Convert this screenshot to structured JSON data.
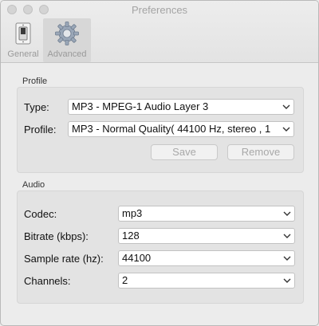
{
  "window": {
    "title": "Preferences"
  },
  "toolbar": {
    "general_label": "General",
    "advanced_label": "Advanced",
    "selected": "Advanced"
  },
  "profile": {
    "section_label": "Profile",
    "type_label": "Type:",
    "type_value": "MP3 - MPEG-1 Audio Layer 3",
    "profile_label": "Profile:",
    "profile_value": "MP3 - Normal Quality( 44100 Hz, stereo , 1",
    "save_label": "Save",
    "remove_label": "Remove"
  },
  "audio": {
    "section_label": "Audio",
    "codec_label": "Codec:",
    "codec_value": "mp3",
    "bitrate_label": "Bitrate (kbps):",
    "bitrate_value": "128",
    "samplerate_label": "Sample rate (hz):",
    "samplerate_value": "44100",
    "channels_label": "Channels:",
    "channels_value": "2"
  },
  "icons": {
    "close": "close-button",
    "minimize": "minimize-button",
    "zoom": "zoom-button",
    "general": "light-switch-icon",
    "advanced": "gear-icon",
    "dropdown": "chevron-down-icon"
  }
}
